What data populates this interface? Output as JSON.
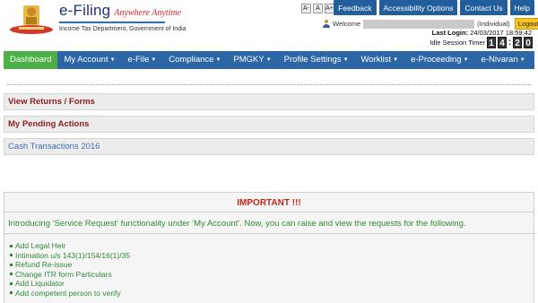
{
  "brand": {
    "name": "e-Filing",
    "tagline": "Anywhere Anytime",
    "subtitle": "Income Tax Department, Government of India"
  },
  "font_size_options": [
    "A-",
    "A",
    "A+",
    "A",
    "A"
  ],
  "top_nav": [
    "Feedback",
    "Accessibility Options",
    "Contact Us",
    "Help"
  ],
  "user": {
    "welcome": "Welcome",
    "role": "(Individual)",
    "logout": "Logout",
    "last_login_label": "Last Login:",
    "last_login_value": "24/03/2017 18:59:42",
    "idle_timer_label": "Idle Session Timer",
    "timer_digits": [
      "1",
      "4",
      "2",
      "0"
    ]
  },
  "main_nav": [
    {
      "label": "Dashboard",
      "active": true,
      "has_caret": false
    },
    {
      "label": "My Account",
      "active": false,
      "has_caret": true
    },
    {
      "label": "e-File",
      "active": false,
      "has_caret": true
    },
    {
      "label": "Compliance",
      "active": false,
      "has_caret": true
    },
    {
      "label": "PMGKY",
      "active": false,
      "has_caret": true
    },
    {
      "label": "Profile Settings",
      "active": false,
      "has_caret": true
    },
    {
      "label": "Worklist",
      "active": false,
      "has_caret": true
    },
    {
      "label": "e-Proceeding",
      "active": false,
      "has_caret": true
    },
    {
      "label": "e-Nivaran",
      "active": false,
      "has_caret": true
    }
  ],
  "panels": [
    {
      "label": "View Returns / Forms"
    },
    {
      "label": "My Pending Actions"
    },
    {
      "label": "Cash Transactions 2016"
    }
  ],
  "important": {
    "heading": "IMPORTANT !!!",
    "intro": "Introducing 'Service Request' functionality under 'My Account'. Now, you can raise and view the requests for the following.",
    "items": [
      "Add Legal Heir",
      "Intimation u/s 143(1)/154/16(1)/35",
      "Refund Re-issue",
      "Change ITR form Particulars",
      "Add Liquidator",
      "Add competent person to verify"
    ]
  },
  "colors": {
    "nav_blue": "#2d66a6",
    "active_green": "#4caf48",
    "panel_red_text": "#8b1d1d",
    "list_green": "#2f8a36",
    "logout_yellow": "#f6c51e"
  }
}
